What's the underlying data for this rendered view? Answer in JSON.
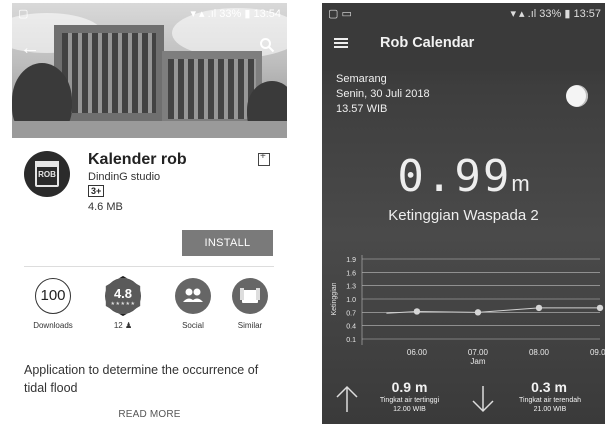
{
  "left_screen": {
    "status_bar": {
      "time": "13:54",
      "battery": "33%"
    },
    "app": {
      "name": "Kalender rob",
      "developer": "DindinG studio",
      "content_rating": "3+",
      "size": "4.6 MB",
      "icon_text": "ROB"
    },
    "install_label": "INSTALL",
    "stats": {
      "downloads_value": "100",
      "downloads_label": "Downloads",
      "rating_value": "4.8",
      "rating_stars": "★★★★★",
      "rating_count": "12 ♟",
      "social_label": "Social",
      "similar_label": "Similar"
    },
    "description": "Application to determine the occurrence of tidal flood",
    "read_more": "READ MORE"
  },
  "right_screen": {
    "status_bar": {
      "time": "13:57",
      "battery": "33%"
    },
    "title": "Rob Calendar",
    "location": {
      "city": "Semarang",
      "date": "Senin, 30 Juli 2018",
      "time": "13.57 WIB"
    },
    "current_height": {
      "value": "0.99",
      "unit": "m"
    },
    "status": "Ketinggian Waspada 2",
    "summary": {
      "max_value": "0.9 m",
      "max_label": "Tingkat air tertinggi",
      "max_time": "12.00 WIB",
      "min_value": "0.3 m",
      "min_label": "Tingkat air terendah",
      "min_time": "21.00 WIB"
    }
  },
  "chart_data": {
    "type": "line",
    "xlabel": "Jam",
    "ylabel": "Ketinggian",
    "x_ticks": [
      "06.00",
      "07.00",
      "08.00",
      "09.00"
    ],
    "y_ticks": [
      "1.9",
      "1.6",
      "1.3",
      "1.0",
      "0.7",
      "0.4",
      "0.1"
    ],
    "ylim": [
      0.1,
      1.9
    ],
    "grid": true,
    "series": [
      {
        "x": [
          "05.30",
          "06.00",
          "07.00",
          "07.30",
          "08.00",
          "09.00"
        ],
        "values": [
          0.68,
          0.72,
          0.7,
          0.75,
          0.8,
          0.8
        ]
      }
    ]
  },
  "colors": {
    "left_background": "#ffffff",
    "right_background": "#3e3e3e",
    "install_button": "#7a7a7a"
  }
}
